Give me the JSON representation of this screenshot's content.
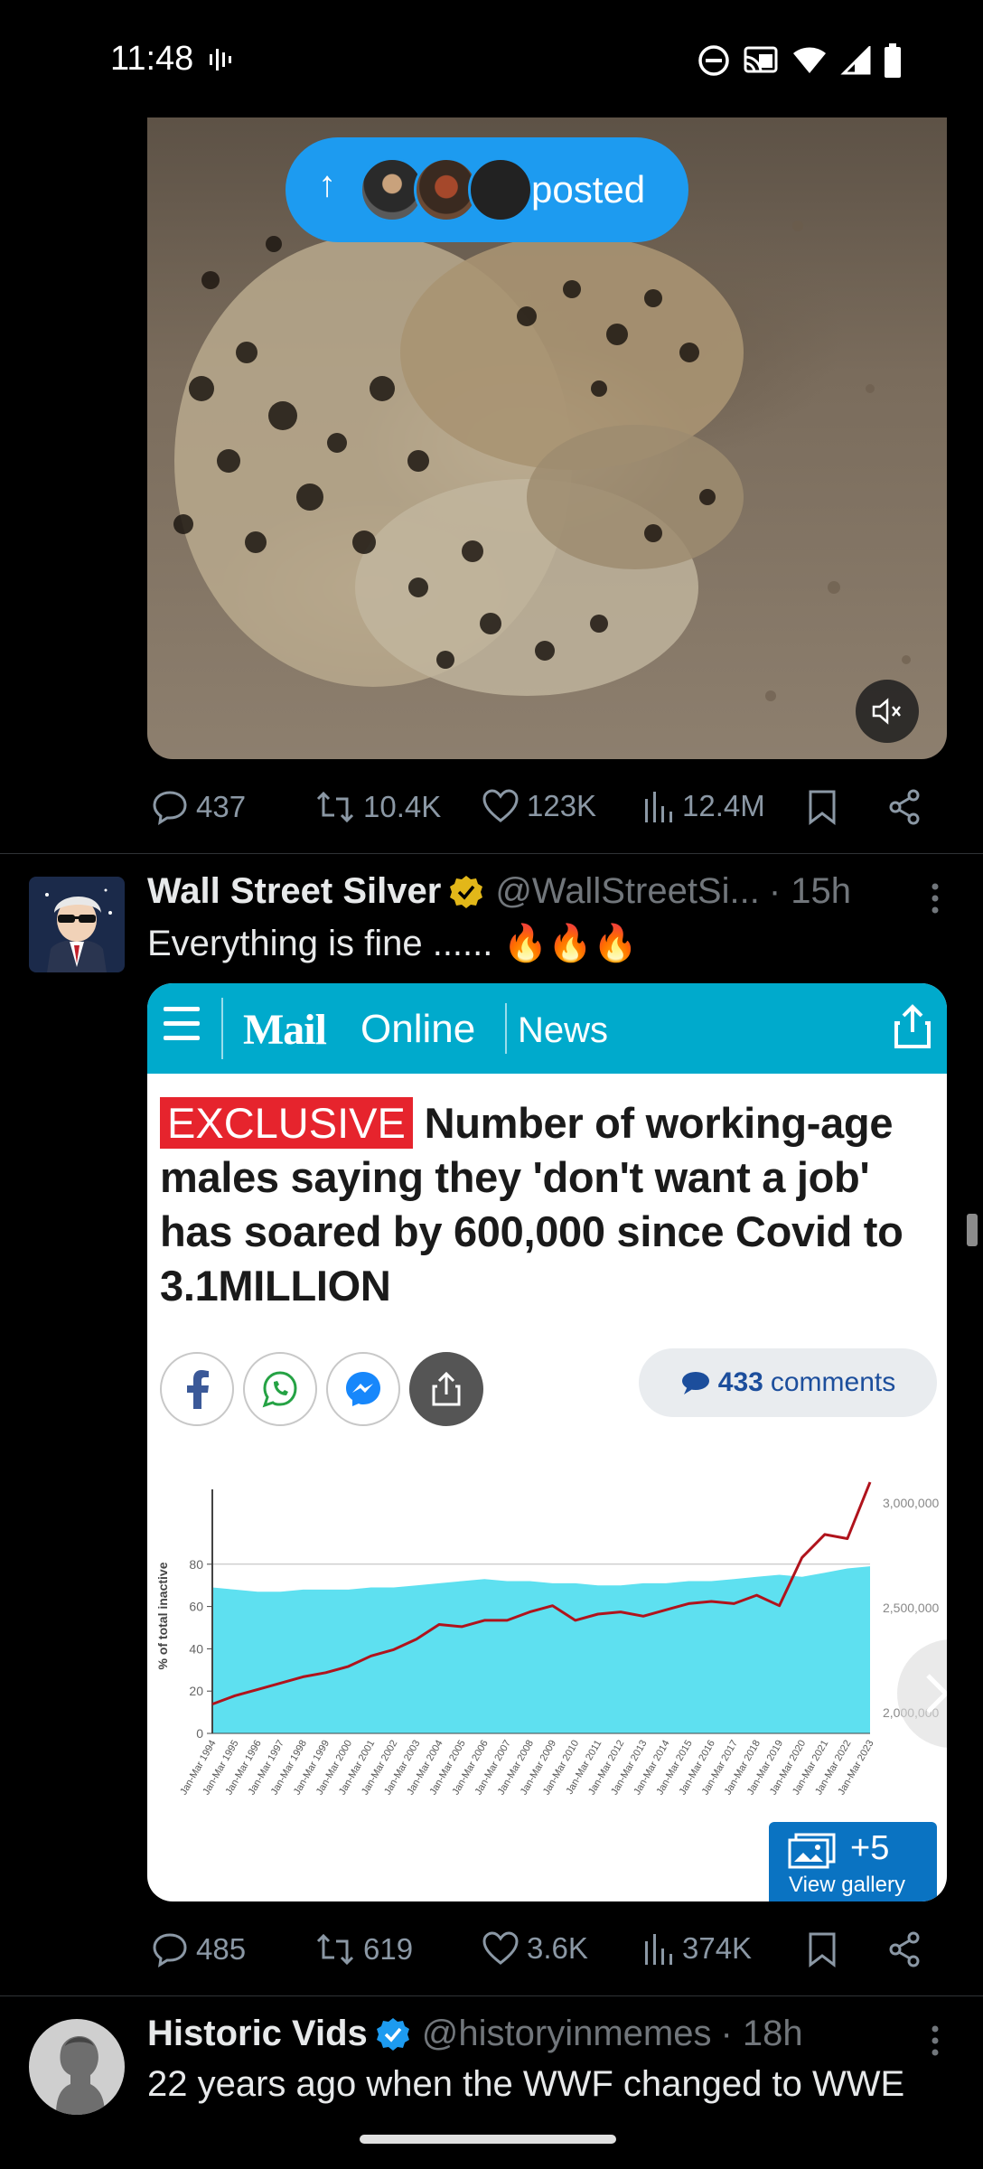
{
  "status_bar": {
    "time": "11:48"
  },
  "tweet1": {
    "posted_label": "posted",
    "stats": {
      "replies": "437",
      "reposts": "10.4K",
      "likes": "123K",
      "views": "12.4M"
    }
  },
  "tweet2": {
    "name": "Wall Street Silver",
    "handle": "@WallStreetSi...",
    "time": "· 15h",
    "text": "Everything is fine ...... 🔥🔥🔥",
    "article": {
      "site_logo": "Mail",
      "site_suffix": "Online",
      "section": "News",
      "tag": "EXCLUSIVE",
      "headline": "Number of working-age males saying they 'don't want a job' has soared by 600,000 since Covid to 3.1MILLION",
      "comments_count": "433",
      "comments_label": "comments",
      "gallery_count": "+5",
      "gallery_label": "View gallery"
    },
    "stats": {
      "replies": "485",
      "reposts": "619",
      "likes": "3.6K",
      "views": "374K"
    }
  },
  "tweet3": {
    "name": "Historic Vids",
    "handle": "@historyinmemes",
    "time": "· 18h",
    "text": "22 years ago when the WWF changed to WWE"
  },
  "chart_data": {
    "type": "area",
    "title": "",
    "xlabel": "",
    "ylabel": "% of total inactive",
    "ylim": [
      0,
      80
    ],
    "y2lim": [
      1900000,
      3100000
    ],
    "yticks": [
      "0",
      "20",
      "40",
      "60",
      "80"
    ],
    "y2ticks": [
      "2,000,000",
      "2,500,000",
      "3,000,000"
    ],
    "x": [
      "Jan-Mar 1994",
      "Jan-Mar 1995",
      "Jan-Mar 1996",
      "Jan-Mar 1997",
      "Jan-Mar 1998",
      "Jan-Mar 1999",
      "Jan-Mar 2000",
      "Jan-Mar 2001",
      "Jan-Mar 2002",
      "Jan-Mar 2003",
      "Jan-Mar 2004",
      "Jan-Mar 2005",
      "Jan-Mar 2006",
      "Jan-Mar 2007",
      "Jan-Mar 2008",
      "Jan-Mar 2009",
      "Jan-Mar 2010",
      "Jan-Mar 2011",
      "Jan-Mar 2012",
      "Jan-Mar 2013",
      "Jan-Mar 2014",
      "Jan-Mar 2015",
      "Jan-Mar 2016",
      "Jan-Mar 2017",
      "Jan-Mar 2018",
      "Jan-Mar 2019",
      "Jan-Mar 2020",
      "Jan-Mar 2021",
      "Jan-Mar 2022",
      "Jan-Mar 2023"
    ],
    "series": [
      {
        "axis": "left",
        "color": "#5ee0f0",
        "values": [
          69,
          68,
          67,
          67,
          68,
          68,
          68,
          69,
          69,
          70,
          71,
          72,
          73,
          72,
          72,
          71,
          71,
          70,
          70,
          71,
          71,
          72,
          72,
          73,
          74,
          75,
          74,
          76,
          78,
          79
        ]
      },
      {
        "axis": "right",
        "color": "#b0131c",
        "values": [
          2040000,
          2080000,
          2110000,
          2140000,
          2170000,
          2190000,
          2220000,
          2270000,
          2300000,
          2350000,
          2420000,
          2410000,
          2440000,
          2440000,
          2480000,
          2510000,
          2440000,
          2470000,
          2480000,
          2460000,
          2490000,
          2520000,
          2530000,
          2520000,
          2560000,
          2510000,
          2740000,
          2850000,
          2830000,
          3100000
        ]
      }
    ]
  }
}
